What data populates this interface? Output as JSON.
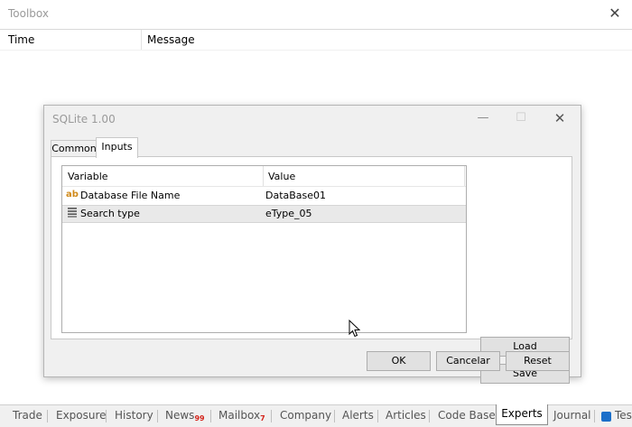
{
  "toolbox": {
    "title": "Toolbox",
    "close_label": "✕",
    "columns": {
      "time": "Time",
      "message": "Message"
    }
  },
  "dialog": {
    "title": "SQLite 1.00",
    "minimize_label": "—",
    "maximize_label": "☐",
    "close_label": "✕",
    "tabs": [
      {
        "label": "Common"
      },
      {
        "label": "Inputs"
      }
    ],
    "grid": {
      "header_variable": "Variable",
      "header_value": "Value",
      "rows": [
        {
          "icon": "ab-string-icon",
          "variable": "Database File Name",
          "value": "DataBase01"
        },
        {
          "icon": "enum-icon",
          "variable": "Search type",
          "value": "eType_05"
        }
      ]
    },
    "buttons": {
      "load": "Load",
      "save": "Save",
      "ok": "OK",
      "cancel": "Cancelar",
      "reset": "Reset"
    }
  },
  "bottom_tabs": {
    "items": [
      {
        "label": "Trade"
      },
      {
        "label": "Exposure"
      },
      {
        "label": "History"
      },
      {
        "label": "News",
        "badge": "99"
      },
      {
        "label": "Mailbox",
        "badge": "7"
      },
      {
        "label": "Company"
      },
      {
        "label": "Alerts"
      },
      {
        "label": "Articles"
      },
      {
        "label": "Code Base"
      },
      {
        "label": "Experts"
      },
      {
        "label": "Journal"
      },
      {
        "label": "Tes"
      }
    ],
    "active": "Experts"
  },
  "colors": {
    "badge": "#d4251c",
    "string_icon": "#d08a1a",
    "tester_icon": "#1b6fc9"
  }
}
